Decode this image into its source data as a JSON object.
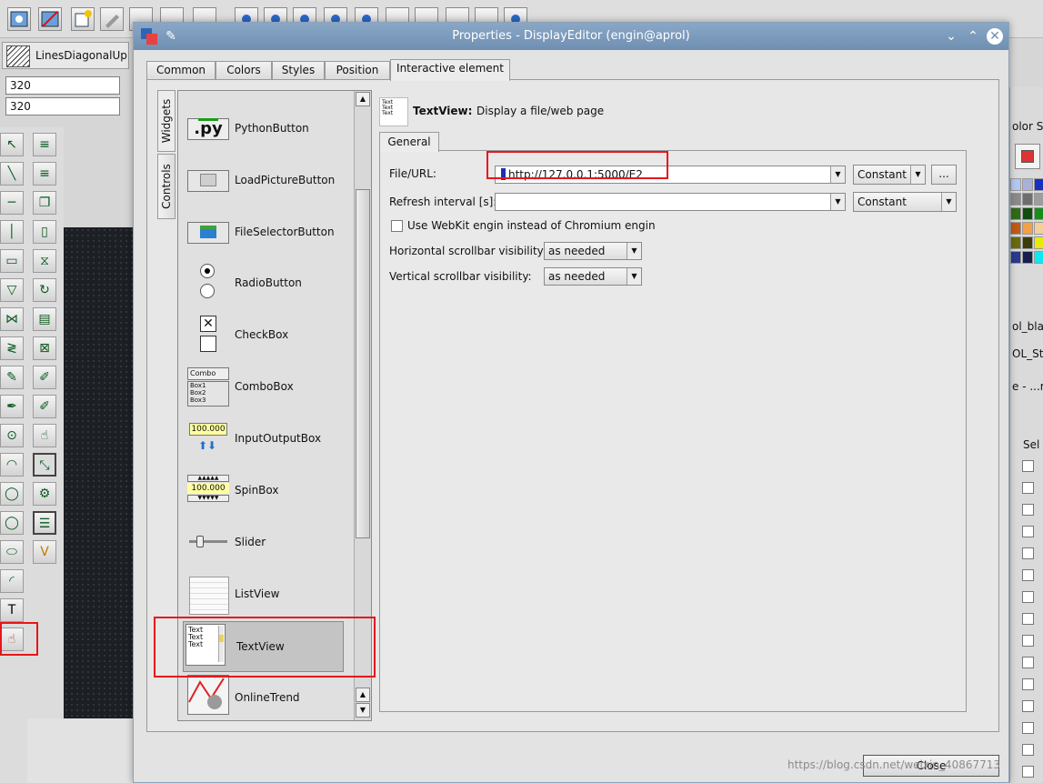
{
  "background": {
    "fill_pattern": {
      "label": "LinesDiagonalUp"
    },
    "coord_x": "320",
    "coord_y": "320",
    "right_panel": {
      "color_select_label": "olor Se",
      "item_1": "ol_blac",
      "item_2": "OL_Sta",
      "item_3": "e - ...r",
      "sel_header": "Sel"
    }
  },
  "dialog": {
    "title": "Properties - DisplayEditor (engin@aprol)",
    "tabs": [
      "Common",
      "Colors",
      "Styles",
      "Position",
      "Interactive element"
    ],
    "active_tab": "Interactive element",
    "vertical_tabs": [
      "Widgets",
      "Controls"
    ],
    "widgets": [
      {
        "label": "PythonButton",
        "icon": "python-button-icon"
      },
      {
        "label": "LoadPictureButton",
        "icon": "load-picture-icon"
      },
      {
        "label": "FileSelectorButton",
        "icon": "file-selector-icon"
      },
      {
        "label": "RadioButton",
        "icon": "radio-button-icon"
      },
      {
        "label": "CheckBox",
        "icon": "checkbox-icon"
      },
      {
        "label": "ComboBox",
        "icon": "combobox-icon"
      },
      {
        "label": "InputOutputBox",
        "icon": "input-output-box-icon"
      },
      {
        "label": "SpinBox",
        "icon": "spinbox-icon"
      },
      {
        "label": "Slider",
        "icon": "slider-icon"
      },
      {
        "label": "ListView",
        "icon": "listview-icon"
      },
      {
        "label": "TextView",
        "icon": "textview-icon"
      },
      {
        "label": "OnlineTrend",
        "icon": "online-trend-icon"
      }
    ],
    "selected_widget": "TextView",
    "header": {
      "title": "TextView:",
      "description": "Display a file/web page"
    },
    "subtab": "General",
    "form": {
      "file_url_label": "File/URL:",
      "file_url_value": "http://127.0.0.1:5000/E2",
      "file_url_mode": "Constant",
      "browse_label": "...",
      "refresh_label": "Refresh interval [s]:",
      "refresh_value": "",
      "refresh_mode": "Constant",
      "webkit_label": "Use WebKit engin instead of Chromium engin",
      "webkit_checked": false,
      "hscroll_label": "Horizontal scrollbar visibility:",
      "hscroll_value": "as needed",
      "vscroll_label": "Vertical scrollbar visibility:",
      "vscroll_value": "as needed"
    },
    "close_label": "Close",
    "icon_text": {
      "py": ".py",
      "combo": "Combo",
      "box1": "Box1",
      "box2": "Box2",
      "box3": "Box3",
      "io_value": "100.000",
      "spin_value": "100.000",
      "text_line": "Text"
    }
  },
  "watermark": "https://blog.csdn.net/weixin_40867713",
  "colors": {
    "highlight": "#e8151b",
    "titlebar": "#7a98bb"
  }
}
